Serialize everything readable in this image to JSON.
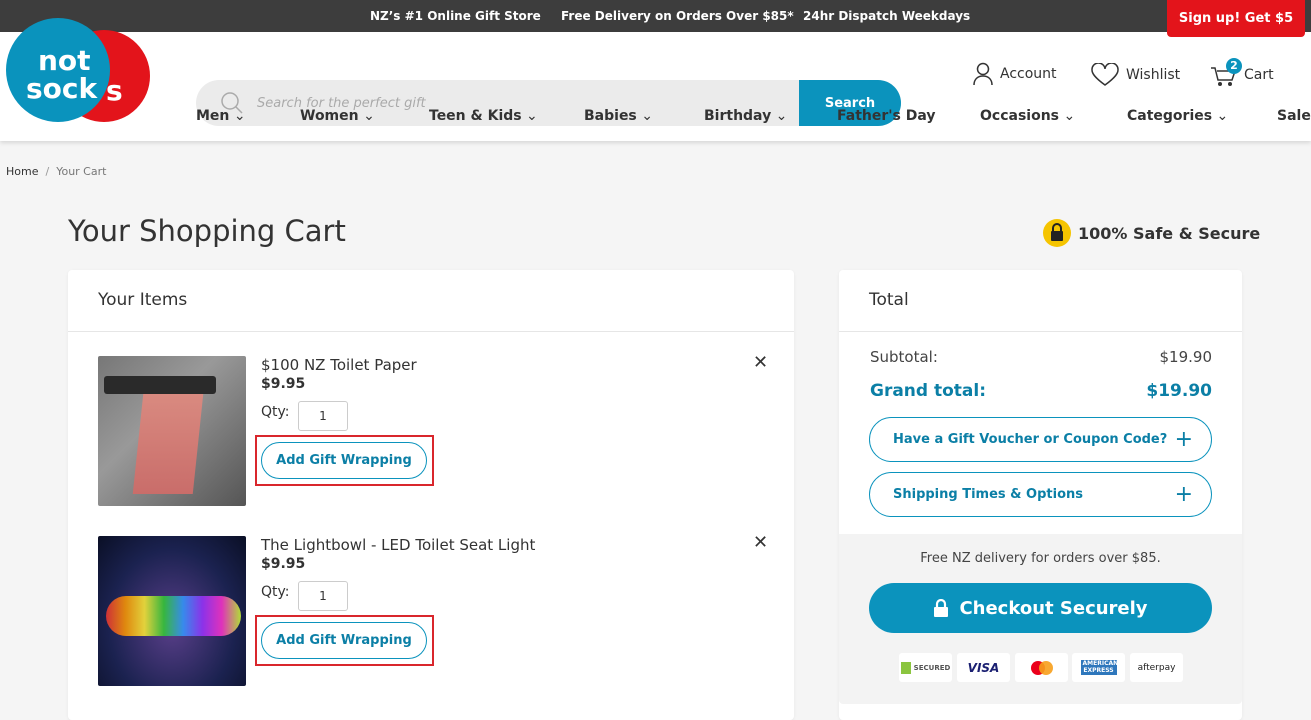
{
  "topbar": {
    "messages": [
      "NZ’s #1 Online Gift Store",
      "Free Delivery on Orders Over $85*",
      "24hr Dispatch Weekdays"
    ],
    "signup": "Sign up! Get $5"
  },
  "header": {
    "logo": "notsocks",
    "search_placeholder": "Search for the perfect gift",
    "search_button": "Search",
    "account": "Account",
    "wishlist": "Wishlist",
    "cart": "Cart",
    "cart_count": "2"
  },
  "nav": [
    {
      "label": "Men",
      "dropdown": true
    },
    {
      "label": "Women",
      "dropdown": true
    },
    {
      "label": "Teen & Kids",
      "dropdown": true
    },
    {
      "label": "Babies",
      "dropdown": true
    },
    {
      "label": "Birthday",
      "dropdown": true
    },
    {
      "label": "Father's Day",
      "dropdown": false
    },
    {
      "label": "Occasions",
      "dropdown": true
    },
    {
      "label": "Categories",
      "dropdown": true
    },
    {
      "label": "Sale",
      "dropdown": false
    }
  ],
  "breadcrumb": {
    "home": "Home",
    "sep": "/",
    "current": "Your Cart"
  },
  "page": {
    "title": "Your Shopping Cart",
    "secure": "100% Safe & Secure"
  },
  "items_card": {
    "title": "Your Items",
    "qty_label": "Qty:",
    "gift_label": "Add Gift Wrapping",
    "items": [
      {
        "name": "$100 NZ Toilet Paper",
        "price": "$9.95",
        "qty": "1"
      },
      {
        "name": "The Lightbowl - LED Toilet Seat Light",
        "price": "$9.95",
        "qty": "1"
      }
    ]
  },
  "total_card": {
    "title": "Total",
    "subtotal_label": "Subtotal:",
    "subtotal": "$19.90",
    "grand_label": "Grand total:",
    "grand": "$19.90",
    "voucher": "Have a Gift Voucher or Coupon Code?",
    "shipping": "Shipping Times & Options",
    "free_delivery": "Free NZ delivery for orders over $85.",
    "checkout": "Checkout Securely",
    "payments": [
      "SECURED",
      "VISA",
      "mastercard",
      "AMERICAN EXPRESS",
      "afterpay"
    ]
  },
  "colors": {
    "accent": "#0b93bd",
    "signup": "#e3141b",
    "topbar": "#3d3d3d"
  }
}
